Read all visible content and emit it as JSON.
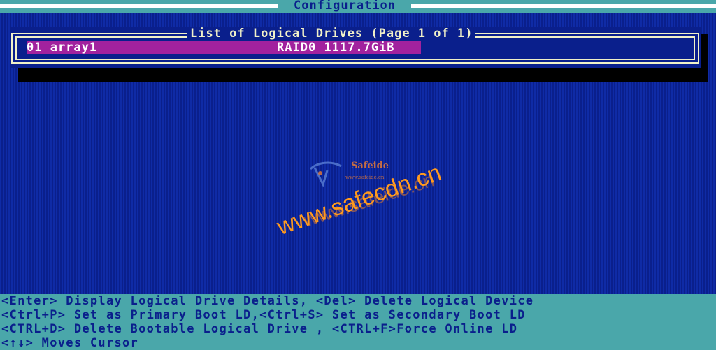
{
  "header": {
    "title": "Configuration"
  },
  "list": {
    "title": "List of Logical Drives (Page 1 of 1)",
    "drives": [
      {
        "name": "01 array1",
        "info": "RAID0 1117.7GiB",
        "selected": true
      }
    ]
  },
  "watermark": {
    "brand": "Safeide",
    "brand_url": "www.safeide.cn",
    "text": "www.safecdn.cn",
    "text_back": "www.safeide.cn"
  },
  "help": {
    "lines": [
      "<Enter> Display Logical Drive Details, <Del> Delete Logical Device",
      "<Ctrl+P> Set as Primary Boot LD,<Ctrl+S> Set as Secondary Boot LD",
      "<CTRL+D> Delete Bootable Logical Drive , <CTRL+F>Force Online LD",
      "<↑↓> Moves Cursor"
    ]
  },
  "colors": {
    "background": "#0f28a0",
    "bar": "#4aa7aa",
    "frame": "#f1f1c8",
    "selection": "#a2229e",
    "watermark": "#ff9a1e"
  }
}
